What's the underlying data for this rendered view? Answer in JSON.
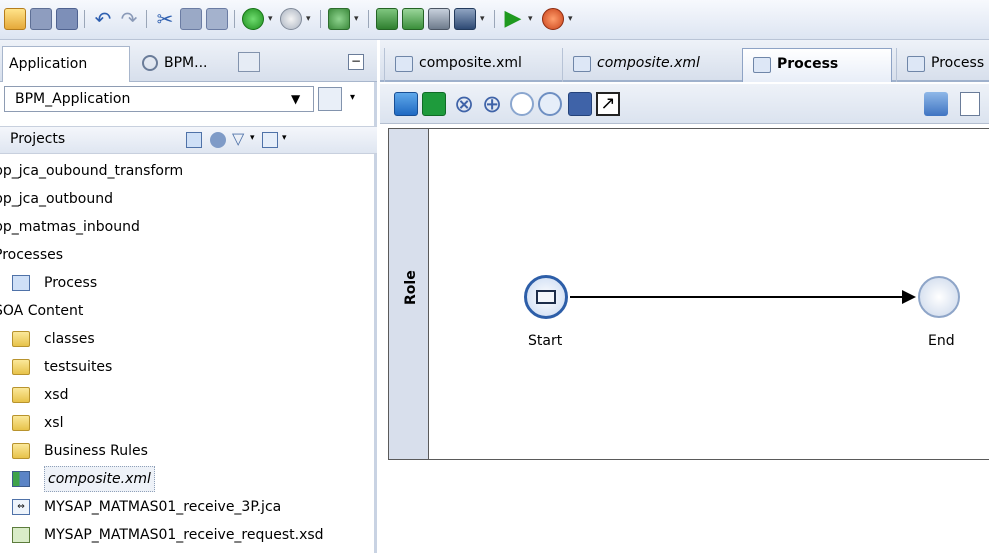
{
  "toolbar": {
    "icons": [
      "open-icon",
      "save-icon",
      "save-all-icon",
      "undo-icon",
      "redo-icon",
      "cut-icon",
      "copy-icon",
      "paste-icon",
      "back-icon",
      "forward-icon",
      "deploy-icon",
      "build-icon",
      "rebuild-icon",
      "make-icon",
      "run-icon",
      "debug-icon"
    ]
  },
  "left_panel": {
    "tabs": [
      {
        "label": "Application"
      },
      {
        "label": "BPM..."
      }
    ],
    "app_selector": {
      "value": "BPM_Application"
    },
    "projects_label": "Projects",
    "tree": [
      {
        "label": "bp_jca_oubound_transform",
        "icon": "project-icon"
      },
      {
        "label": "bp_jca_outbound",
        "icon": "project-icon"
      },
      {
        "label": "bp_matmas_inbound",
        "icon": "project-icon"
      },
      {
        "label": "Processes",
        "icon": "folder-icon"
      },
      {
        "label": "Process",
        "icon": "process-icon"
      },
      {
        "label": "SOA Content",
        "icon": "folder-icon"
      },
      {
        "label": "classes",
        "icon": "folder-icon"
      },
      {
        "label": "testsuites",
        "icon": "folder-icon"
      },
      {
        "label": "xsd",
        "icon": "folder-icon"
      },
      {
        "label": "xsl",
        "icon": "folder-icon"
      },
      {
        "label": "Business Rules",
        "icon": "folder-icon"
      },
      {
        "label": "composite.xml",
        "icon": "composite-icon"
      },
      {
        "label": "MYSAP_MATMAS01_receive_3P.jca",
        "icon": "jca-icon"
      },
      {
        "label": "MYSAP_MATMAS01_receive_request.xsd",
        "icon": "xsd-icon"
      }
    ]
  },
  "editor": {
    "tabs": [
      {
        "label": "composite.xml"
      },
      {
        "label": "composite.xml"
      },
      {
        "label": "Process"
      },
      {
        "label": "Process"
      }
    ],
    "lane_label": "Role",
    "start_label": "Start",
    "end_label": "End"
  },
  "colors": {
    "accent": "#3a6cc8",
    "lane": "#d8dfec"
  }
}
